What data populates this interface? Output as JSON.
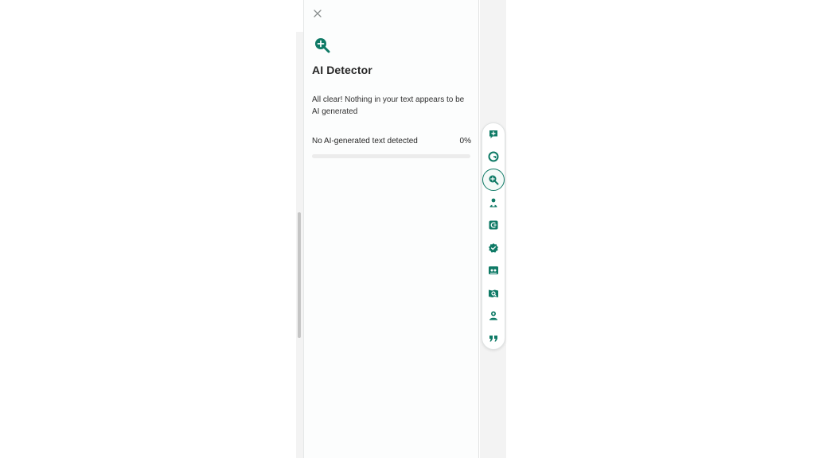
{
  "panel": {
    "title": "AI Detector",
    "description": "All clear! Nothing in your text appears to be AI generated",
    "result_label": "No AI-generated text detected",
    "result_percent": "0%",
    "progress_fraction": 0,
    "icon": "magnifier-plus-icon",
    "close_icon": "close-icon"
  },
  "toolbar": {
    "items": [
      {
        "icon": "chat-plus-icon",
        "active": false
      },
      {
        "icon": "grammarly-logo-icon",
        "active": false
      },
      {
        "icon": "ai-detector-icon",
        "active": true
      },
      {
        "icon": "person-document-icon",
        "active": false
      },
      {
        "icon": "rewrite-icon",
        "active": false
      },
      {
        "icon": "verified-badge-icon",
        "active": false
      },
      {
        "icon": "reader-icon",
        "active": false
      },
      {
        "icon": "plagiarism-search-icon",
        "active": false
      },
      {
        "icon": "expert-icon",
        "active": false
      },
      {
        "icon": "quote-icon",
        "active": false
      }
    ]
  },
  "colors": {
    "accent": "#0f7a66",
    "text": "#262626",
    "track": "#ececec"
  }
}
